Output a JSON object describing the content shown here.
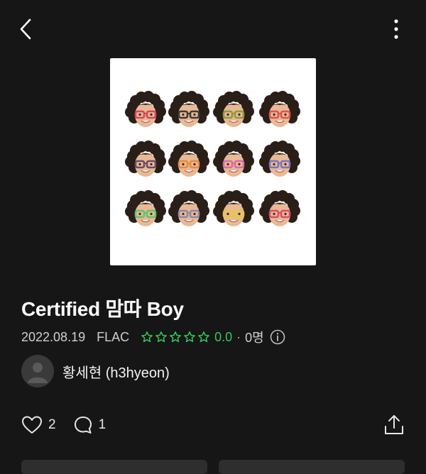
{
  "album": {
    "title": "Certified 맘따 Boy",
    "date": "2022.08.19",
    "format": "FLAC",
    "rating": "0.0",
    "rating_count": "0명",
    "star_count": 5
  },
  "artist": {
    "name": "황세현 (h3hyeon)"
  },
  "actions": {
    "like_count": "2",
    "comment_count": "1"
  },
  "icons": {
    "back": "chevron-left-icon",
    "more": "more-vertical-icon",
    "info": "info-icon",
    "like": "heart-icon",
    "comment": "comment-icon",
    "share": "share-icon"
  },
  "cover": {
    "glasses_colors": [
      "#d9445a",
      "#3a3a3a",
      "#8a9a3a",
      "#e0524e",
      "#6a4a6a",
      "#e88a3a",
      "#d86aa8",
      "#7a72c8",
      "#5ac870",
      "#8a8aa8",
      "#e8c840",
      "#e04a6a"
    ]
  },
  "colors": {
    "background": "#161616",
    "accent_green": "#34c759"
  }
}
